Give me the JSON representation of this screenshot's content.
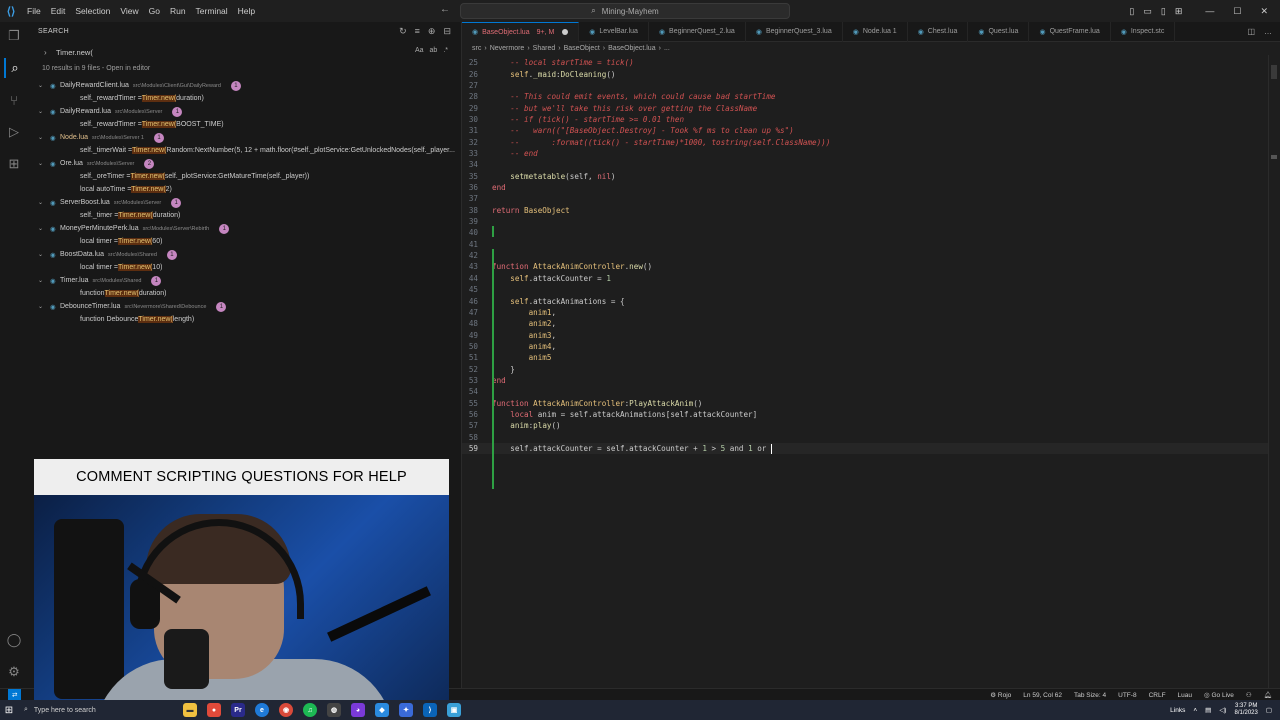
{
  "app": {
    "title": "Mining-Mayhem",
    "menu": [
      "File",
      "Edit",
      "Selection",
      "View",
      "Go",
      "Run",
      "Terminal",
      "Help"
    ]
  },
  "sidebar": {
    "header": "SEARCH",
    "search_value": "Timer.new(",
    "summary": "10 results in 9 files - Open in editor",
    "groups": [
      {
        "file": "DailyRewardClient.lua",
        "path": "src\\Modules\\Client\\Gui\\DailyReward",
        "count": "1",
        "matches": [
          [
            "self._rewardTimer = ",
            "Timer.new(",
            "duration)"
          ]
        ]
      },
      {
        "file": "DailyReward.lua",
        "path": "src\\Modules\\Server",
        "count": "1",
        "matches": [
          [
            "self._rewardTimer = ",
            "Timer.new(",
            "BOOST_TIME)"
          ]
        ]
      },
      {
        "file": "Node.lua",
        "path": "src\\Modules\\Server 1",
        "count": "1",
        "modified": true,
        "matches": [
          [
            "self._timerWait = ",
            "Timer.new(",
            "Random:NextNumber(5, 12 + math.floor(#self._plotService:GetUnlockedNodes(self._player..."
          ]
        ]
      },
      {
        "file": "Ore.lua",
        "path": "src\\Modules\\Server",
        "count": "2",
        "matches": [
          [
            "self._oreTimer = ",
            "Timer.new(",
            "self._plotService:GetMatureTime(self._player))"
          ],
          [
            "local autoTime = ",
            "Timer.new(",
            "2)"
          ]
        ]
      },
      {
        "file": "ServerBoost.lua",
        "path": "src\\Modules\\Server",
        "count": "1",
        "matches": [
          [
            "self._timer = ",
            "Timer.new(",
            "duration)"
          ]
        ]
      },
      {
        "file": "MoneyPerMinutePerk.lua",
        "path": "src\\Modules\\Server\\Rebirth",
        "count": "1",
        "matches": [
          [
            "local timer = ",
            "Timer.new(",
            "60)"
          ]
        ]
      },
      {
        "file": "BoostData.lua",
        "path": "src\\Modules\\Shared",
        "count": "1",
        "matches": [
          [
            "local timer = ",
            "Timer.new(",
            "10)"
          ]
        ]
      },
      {
        "file": "Timer.lua",
        "path": "src\\Modules\\Shared",
        "count": "1",
        "matches": [
          [
            "function ",
            "Timer.new(",
            "duration)"
          ]
        ]
      },
      {
        "file": "DebounceTimer.lua",
        "path": "src\\Nevermore\\Shared\\Debounce",
        "count": "1",
        "matches": [
          [
            "function Debounce",
            "Timer.new(",
            "length)"
          ]
        ]
      }
    ]
  },
  "tabs": [
    {
      "label": "BaseObject.lua",
      "badge": "9+, M",
      "active": true
    },
    {
      "label": "LevelBar.lua"
    },
    {
      "label": "BeginnerQuest_2.lua"
    },
    {
      "label": "BeginnerQuest_3.lua"
    },
    {
      "label": "Node.lua 1"
    },
    {
      "label": "Chest.lua"
    },
    {
      "label": "Quest.lua"
    },
    {
      "label": "QuestFrame.lua"
    },
    {
      "label": "Inspect.stc"
    }
  ],
  "breadcrumb": [
    "src",
    "Nevermore",
    "Shared",
    "BaseObject",
    "BaseObject.lua",
    "..."
  ],
  "editor": {
    "lines": [
      {
        "n": "25",
        "html": "    <span class='cm'>-- local startTime = tick()</span>"
      },
      {
        "n": "26",
        "html": "    <span class='self'>self</span><span class='plain'>.</span><span class='fn'>_maid</span><span class='plain'>:</span><span class='fn'>DoCleaning</span><span class='plain'>()</span>"
      },
      {
        "n": "27",
        "html": ""
      },
      {
        "n": "28",
        "html": "    <span class='cm'>-- This could emit events, which could cause bad startTime</span>"
      },
      {
        "n": "29",
        "html": "    <span class='cm'>-- but we'll take this risk over getting the ClassName</span>"
      },
      {
        "n": "30",
        "html": "    <span class='cm'>-- if (tick() - startTime >= 0.01 then</span>"
      },
      {
        "n": "31",
        "html": "    <span class='cm'>--   warn((\"[BaseObject.Destroy] - Took %f ms to clean up %s\")</span>"
      },
      {
        "n": "32",
        "html": "    <span class='cm'>--       :format((tick() - startTime)*1000, tostring(self.ClassName)))</span>"
      },
      {
        "n": "33",
        "html": "    <span class='cm'>-- end</span>"
      },
      {
        "n": "34",
        "html": ""
      },
      {
        "n": "35",
        "html": "    <span class='fn'>setmetatable</span><span class='plain'>(self, </span><span class='kwr'>nil</span><span class='plain'>)</span>"
      },
      {
        "n": "36",
        "html": "<span class='kwr'>end</span>"
      },
      {
        "n": "37",
        "html": ""
      },
      {
        "n": "38",
        "html": "<span class='kwr'>return</span> <span class='id'>BaseObject</span>"
      },
      {
        "n": "39",
        "html": ""
      },
      {
        "n": "40",
        "html": ""
      },
      {
        "n": "41",
        "html": ""
      },
      {
        "n": "42",
        "html": ""
      },
      {
        "n": "43",
        "html": "<span class='kwr'>function</span> <span class='id'>AttackAnimController</span><span class='plain'>.</span><span class='fn'>new</span><span class='plain'>()</span>"
      },
      {
        "n": "44",
        "html": "    <span class='self'>self</span><span class='plain'>.attackCounter = </span><span class='num'>1</span>"
      },
      {
        "n": "45",
        "html": ""
      },
      {
        "n": "46",
        "html": "    <span class='self'>self</span><span class='plain'>.attackAnimations = {</span>"
      },
      {
        "n": "47",
        "html": "        <span class='id'>anim1</span><span class='plain'>,</span>"
      },
      {
        "n": "48",
        "html": "        <span class='id'>anim2</span><span class='plain'>,</span>"
      },
      {
        "n": "49",
        "html": "        <span class='id'>anim3</span><span class='plain'>,</span>"
      },
      {
        "n": "50",
        "html": "        <span class='id'>anim4</span><span class='plain'>,</span>"
      },
      {
        "n": "51",
        "html": "        <span class='id'>anim5</span>"
      },
      {
        "n": "52",
        "html": "    <span class='plain'>}</span>"
      },
      {
        "n": "53",
        "html": "<span class='kwr'>end</span>"
      },
      {
        "n": "54",
        "html": ""
      },
      {
        "n": "55",
        "html": "<span class='kwr'>function</span> <span class='id'>AttackAnimController</span><span class='plain'>:</span><span class='fn'>PlayAttackAnim</span><span class='plain'>()</span>"
      },
      {
        "n": "56",
        "html": "    <span class='kwr'>local</span> <span class='plain'>anim = self.attackAnimations[self.attackCounter]</span>"
      },
      {
        "n": "57",
        "html": "    <span class='fn'>anim</span><span class='plain'>:</span><span class='fn'>play</span><span class='plain'>()</span>"
      },
      {
        "n": "58",
        "html": ""
      },
      {
        "n": "59",
        "html": "    <span class='plain'>self.attackCounter = self.attackCounter + </span><span class='num'>1</span><span class='plain'> > </span><span class='num'>5</span><span class='plain'> and </span><span class='num'>1</span><span class='plain'> or </span>",
        "current": true
      }
    ]
  },
  "status": {
    "left": [
      "Rojo"
    ],
    "position": "Ln 59, Col 62",
    "tab_size": "Tab Size: 4",
    "encoding": "UTF-8",
    "eol": "CRLF",
    "language": "Luau",
    "golive": "Go Live"
  },
  "taskbar": {
    "search_placeholder": "Type here to search",
    "links": "Links",
    "time": "3:37 PM",
    "date": "8/1/2023"
  },
  "overlay": {
    "banner": "COMMENT SCRIPTING QUESTIONS FOR HELP"
  }
}
